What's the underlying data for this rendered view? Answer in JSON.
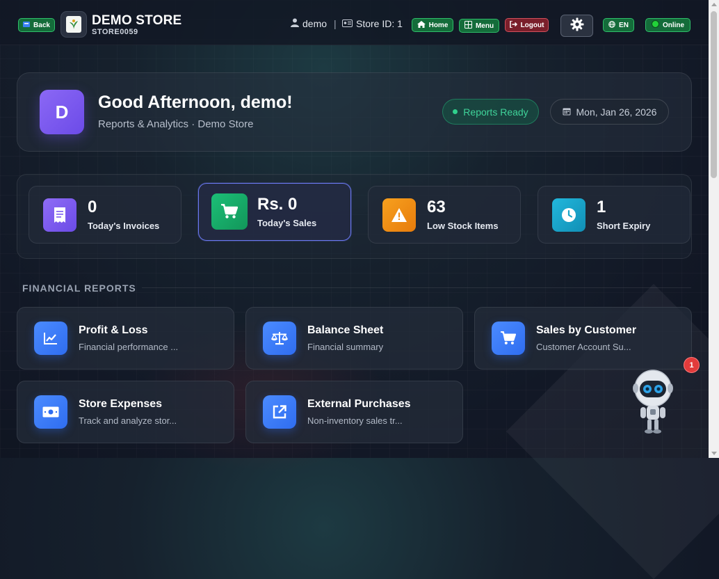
{
  "header": {
    "back_label": "Back",
    "store_name": "DEMO STORE",
    "store_code": "STORE0059",
    "username": "demo",
    "separator": "|",
    "store_id": "Store ID: 1",
    "home_label": "Home",
    "menu_label": "Menu",
    "logout_label": "Logout",
    "language_label": "EN",
    "status_label": "Online"
  },
  "welcome": {
    "avatar_initial": "D",
    "greeting": "Good Afternoon, demo!",
    "subtitle": "Reports & Analytics · Demo Store",
    "status_pill": "Reports Ready",
    "date": "Mon, Jan 26, 2026"
  },
  "stats": [
    {
      "value": "0",
      "label": "Today's Invoices",
      "icon": "receipt-icon",
      "color": "#7c5cf0"
    },
    {
      "value": "Rs. 0",
      "label": "Today's Sales",
      "icon": "cart-icon",
      "color": "#16a765"
    },
    {
      "value": "63",
      "label": "Low Stock Items",
      "icon": "warning-icon",
      "color": "#f08a12"
    },
    {
      "value": "1",
      "label": "Short Expiry",
      "icon": "clock-icon",
      "color": "#19a5c9"
    }
  ],
  "section": {
    "title": "FINANCIAL REPORTS"
  },
  "reports": [
    {
      "title": "Profit & Loss",
      "desc": "Financial performance ...",
      "icon": "chart-line-icon"
    },
    {
      "title": "Balance Sheet",
      "desc": "Financial summary",
      "icon": "scale-icon"
    },
    {
      "title": "Sales by Customer",
      "desc": "Customer Account Su...",
      "icon": "cart-icon"
    },
    {
      "title": "Store Expenses",
      "desc": "Track and analyze stor...",
      "icon": "money-icon"
    },
    {
      "title": "External Purchases",
      "desc": "Non-inventory sales tr...",
      "icon": "external-link-icon"
    }
  ],
  "assistant": {
    "notification_count": "1"
  },
  "colors": {
    "accent_green": "#2fbf6a",
    "accent_red": "#d0505c",
    "report_blue": "#2f6df0"
  }
}
